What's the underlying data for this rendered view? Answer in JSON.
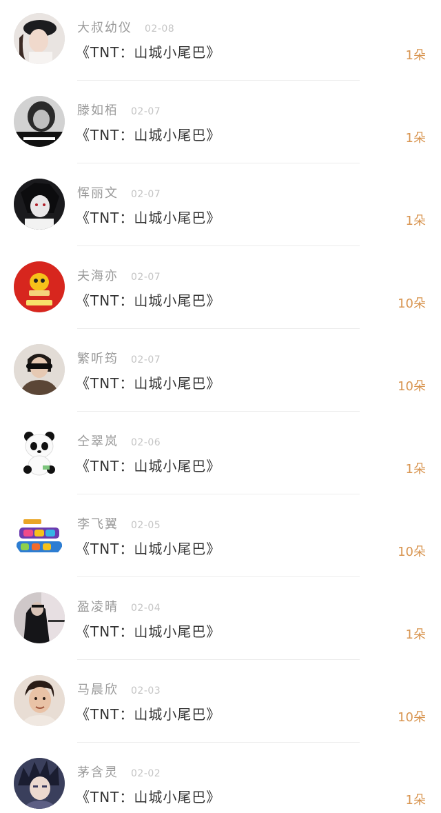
{
  "items": [
    {
      "name": "大叔幼仪",
      "date": "02-08",
      "work": "《TNT：山城小尾巴》",
      "count": "1朵",
      "avatar": "avatar-woman-cap"
    },
    {
      "name": "滕如栢",
      "date": "02-07",
      "work": "《TNT：山城小尾巴》",
      "count": "1朵",
      "avatar": "avatar-bw-girl-caption"
    },
    {
      "name": "恽丽文",
      "date": "02-07",
      "work": "《TNT：山城小尾巴》",
      "count": "1朵",
      "avatar": "avatar-anime-dark"
    },
    {
      "name": "夫海亦",
      "date": "02-07",
      "work": "《TNT：山城小尾巴》",
      "count": "10朵",
      "avatar": "avatar-red-badge"
    },
    {
      "name": "繁听筠",
      "date": "02-07",
      "work": "《TNT：山城小尾巴》",
      "count": "10朵",
      "avatar": "avatar-sunglasses"
    },
    {
      "name": "仝翠岚",
      "date": "02-06",
      "work": "《TNT：山城小尾巴》",
      "count": "1朵",
      "avatar": "avatar-panda"
    },
    {
      "name": "李飞翼",
      "date": "02-05",
      "work": "《TNT：山城小尾巴》",
      "count": "10朵",
      "avatar": "avatar-happy-new-year"
    },
    {
      "name": "盈凌晴",
      "date": "02-04",
      "work": "《TNT：山城小尾巴》",
      "count": "1朵",
      "avatar": "avatar-dark-figure"
    },
    {
      "name": "马晨欣",
      "date": "02-03",
      "work": "《TNT：山城小尾巴》",
      "count": "10朵",
      "avatar": "avatar-man-portrait"
    },
    {
      "name": "茅含灵",
      "date": "02-02",
      "work": "《TNT：山城小尾巴》",
      "count": "1朵",
      "avatar": "avatar-anime-spiky"
    }
  ],
  "colors": {
    "name": "#9a9a9a",
    "date": "#c4c4c4",
    "work": "#333333",
    "count": "#d8944f",
    "divider": "#ececec"
  }
}
